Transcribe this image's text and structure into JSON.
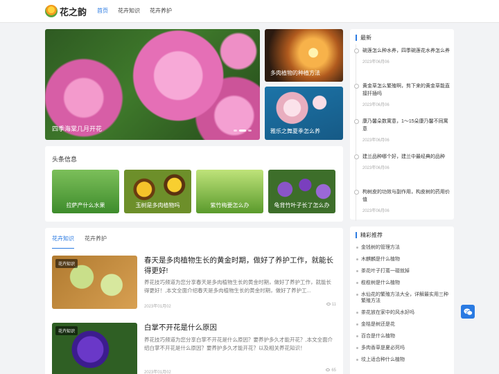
{
  "header": {
    "logo_text": "花之韵",
    "nav": [
      {
        "label": "首页",
        "active": true
      },
      {
        "label": "花卉知识",
        "active": false
      },
      {
        "label": "花卉养护",
        "active": false
      }
    ]
  },
  "hero": {
    "main_caption": "四季海棠几月开花",
    "side1_caption": "多肉植物的种植方法",
    "side2_caption": "雅乐之舞夏季怎么养"
  },
  "headline": {
    "title": "头条信息",
    "items": [
      {
        "caption": "拉萨产什么水果"
      },
      {
        "caption": "玉树是多肉植物吗"
      },
      {
        "caption": "紫竹梅要怎么办"
      },
      {
        "caption": "龟背竹叶子长了怎么办"
      }
    ]
  },
  "list": {
    "tabs": [
      {
        "label": "花卉知识",
        "active": true
      },
      {
        "label": "花卉养护",
        "active": false
      }
    ],
    "articles": [
      {
        "badge": "花卉知识",
        "title": "春天是多肉植物生长的黄金时期，做好了养护工作，就能长得更好!",
        "desc": "养花技巧频道为您分享春天是多肉植物生长的黄金时期，做好了养护工作，就能长得更好！,本文全面介绍春天是多肉植物生长的黄金时期，做好了养护工...",
        "date": "2023年01月02",
        "views": "11"
      },
      {
        "badge": "花卉知识",
        "title": "白掌不开花是什么原因",
        "desc": "养花技巧频道为您分享白掌不开花是什么原因？要养护多久才能开花？,本文全面介绍白掌不开花是什么原因？要养护多久才能开花？以及相关养花知识！",
        "date": "2023年01月02",
        "views": "65"
      }
    ]
  },
  "sidebar": {
    "latest_title": "最新",
    "latest": [
      {
        "title": "碗莲怎么种水养，四季碗莲花水养怎么养",
        "date": "2023年06月06"
      },
      {
        "title": "黄金草怎么繁殖啊，剪下来的黄金草能直接扦插吗",
        "date": "2023年06月06"
      },
      {
        "title": "康乃馨朵数寓意，1〜15朵康乃馨不同寓意",
        "date": "2023年06月06"
      },
      {
        "title": "建兰品种哪个好，建兰中最经典的品种",
        "date": "2023年06月06"
      },
      {
        "title": "枸树皮的功效与副作用，构皮树的药用价值",
        "date": "2023年06月06"
      }
    ],
    "recommend_title": "精彩推荐",
    "recommend": [
      "金钱树的管理方法",
      "木麒麟是什么植物",
      "茶花叶子打蔫一碰就掉",
      "榄榄树是什么植物",
      "水仙花的繁殖方法大全，详解最实用三种繁殖方法",
      "茶花放在家中的风水好吗",
      "金桔是树还是花",
      "百合是什么植物",
      "多肉香草是夏必死吗",
      "坟上适合种什么植物"
    ]
  },
  "colors": {
    "accent": "#2a7ae2",
    "background": "#f2f3f5"
  }
}
